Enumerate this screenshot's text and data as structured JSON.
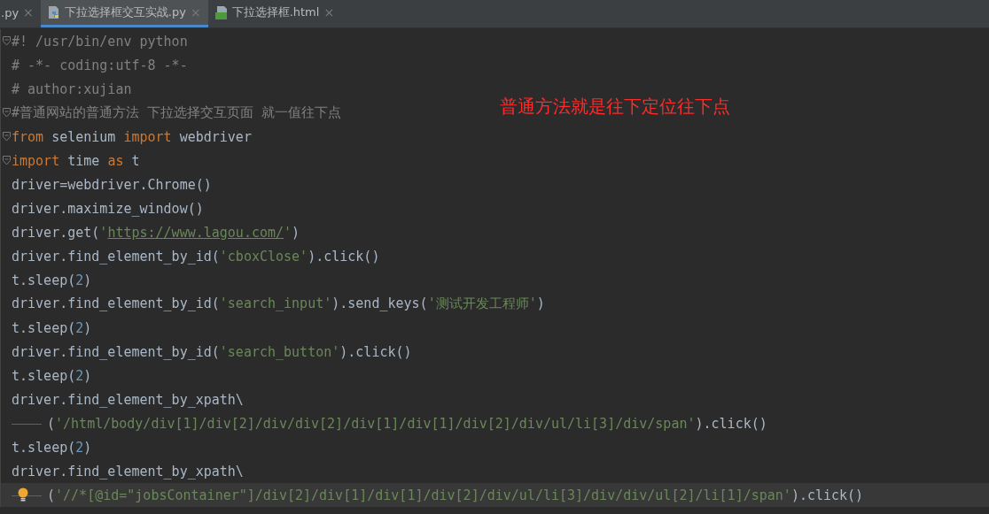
{
  "tabs": [
    {
      "label": ".py",
      "kind": "plain",
      "selected": false,
      "close": "×"
    },
    {
      "label": "下拉选择框交互实战.py",
      "kind": "python",
      "selected": true,
      "close": "×"
    },
    {
      "label": "下拉选择框.html",
      "kind": "html",
      "selected": false,
      "close": "×"
    }
  ],
  "lines": [
    {
      "fold": true,
      "wrap": false,
      "current": false,
      "hint": false,
      "tokens": [
        {
          "kind": "comment",
          "text": "#! /usr/bin/env python"
        }
      ]
    },
    {
      "fold": false,
      "wrap": false,
      "current": false,
      "hint": false,
      "tokens": [
        {
          "kind": "comment",
          "text": "# -*- coding:utf-8 -*-"
        }
      ]
    },
    {
      "fold": false,
      "wrap": false,
      "current": false,
      "hint": false,
      "tokens": [
        {
          "kind": "comment",
          "text": "# author:xujian"
        }
      ]
    },
    {
      "fold": true,
      "wrap": false,
      "current": false,
      "hint": false,
      "tokens": [
        {
          "kind": "comment",
          "text": "#普通网站的普通方法 下拉选择交互页面 就一值往下点"
        }
      ]
    },
    {
      "fold": true,
      "wrap": false,
      "current": false,
      "hint": false,
      "tokens": [
        {
          "kind": "keyword",
          "text": "from"
        },
        {
          "kind": "plain",
          "text": " selenium "
        },
        {
          "kind": "keyword",
          "text": "import"
        },
        {
          "kind": "plain",
          "text": " webdriver"
        }
      ]
    },
    {
      "fold": true,
      "wrap": false,
      "current": false,
      "hint": false,
      "tokens": [
        {
          "kind": "keyword",
          "text": "import"
        },
        {
          "kind": "plain",
          "text": " time "
        },
        {
          "kind": "keyword",
          "text": "as"
        },
        {
          "kind": "plain",
          "text": " t"
        }
      ]
    },
    {
      "fold": false,
      "wrap": false,
      "current": false,
      "hint": false,
      "tokens": [
        {
          "kind": "plain",
          "text": "driver=webdriver.Chrome()"
        }
      ]
    },
    {
      "fold": false,
      "wrap": false,
      "current": false,
      "hint": false,
      "tokens": [
        {
          "kind": "plain",
          "text": "driver.maximize_window()"
        }
      ]
    },
    {
      "fold": false,
      "wrap": false,
      "current": false,
      "hint": false,
      "tokens": [
        {
          "kind": "plain",
          "text": "driver.get("
        },
        {
          "kind": "string",
          "text": "'"
        },
        {
          "kind": "link",
          "text": "https://www.lagou.com/"
        },
        {
          "kind": "string",
          "text": "'"
        },
        {
          "kind": "plain",
          "text": ")"
        }
      ]
    },
    {
      "fold": false,
      "wrap": false,
      "current": false,
      "hint": false,
      "tokens": [
        {
          "kind": "plain",
          "text": "driver.find_element_by_id("
        },
        {
          "kind": "string",
          "text": "'cboxClose'"
        },
        {
          "kind": "plain",
          "text": ").click()"
        }
      ]
    },
    {
      "fold": false,
      "wrap": false,
      "current": false,
      "hint": false,
      "tokens": [
        {
          "kind": "plain",
          "text": "t.sleep("
        },
        {
          "kind": "number",
          "text": "2"
        },
        {
          "kind": "plain",
          "text": ")"
        }
      ]
    },
    {
      "fold": false,
      "wrap": false,
      "current": false,
      "hint": false,
      "tokens": [
        {
          "kind": "plain",
          "text": "driver.find_element_by_id("
        },
        {
          "kind": "string",
          "text": "'search_input'"
        },
        {
          "kind": "plain",
          "text": ").send_keys("
        },
        {
          "kind": "string",
          "text": "'测试开发工程师'"
        },
        {
          "kind": "plain",
          "text": ")"
        }
      ]
    },
    {
      "fold": false,
      "wrap": false,
      "current": false,
      "hint": false,
      "tokens": [
        {
          "kind": "plain",
          "text": "t.sleep("
        },
        {
          "kind": "number",
          "text": "2"
        },
        {
          "kind": "plain",
          "text": ")"
        }
      ]
    },
    {
      "fold": false,
      "wrap": false,
      "current": false,
      "hint": false,
      "tokens": [
        {
          "kind": "plain",
          "text": "driver.find_element_by_id("
        },
        {
          "kind": "string",
          "text": "'search_button'"
        },
        {
          "kind": "plain",
          "text": ").click()"
        }
      ]
    },
    {
      "fold": false,
      "wrap": false,
      "current": false,
      "hint": false,
      "tokens": [
        {
          "kind": "plain",
          "text": "t.sleep("
        },
        {
          "kind": "number",
          "text": "2"
        },
        {
          "kind": "plain",
          "text": ")"
        }
      ]
    },
    {
      "fold": false,
      "wrap": false,
      "current": false,
      "hint": false,
      "tokens": [
        {
          "kind": "plain",
          "text": "driver.find_element_by_xpath\\"
        }
      ]
    },
    {
      "fold": false,
      "wrap": true,
      "current": false,
      "hint": false,
      "tokens": [
        {
          "kind": "plain",
          "text": "("
        },
        {
          "kind": "string",
          "text": "'/html/body/div[1]/div[2]/div/div[2]/div[1]/div[1]/div[2]/div/ul/li[3]/div/span'"
        },
        {
          "kind": "plain",
          "text": ").click()"
        }
      ]
    },
    {
      "fold": false,
      "wrap": false,
      "current": false,
      "hint": false,
      "tokens": [
        {
          "kind": "plain",
          "text": "t.sleep("
        },
        {
          "kind": "number",
          "text": "2"
        },
        {
          "kind": "plain",
          "text": ")"
        }
      ]
    },
    {
      "fold": false,
      "wrap": false,
      "current": false,
      "hint": false,
      "tokens": [
        {
          "kind": "plain",
          "text": "driver.find_element_by_xpath\\"
        }
      ]
    },
    {
      "fold": false,
      "wrap": true,
      "current": true,
      "hint": true,
      "tokens": [
        {
          "kind": "plain",
          "text": "("
        },
        {
          "kind": "string",
          "text": "'//*[@id=\"jobsContainer\"]/div[2]/div[1]/div[1]/div[2]/div/ul/li[3]/div/div/ul[2]/li[1]/span'"
        },
        {
          "kind": "plain",
          "text": ").click()"
        }
      ]
    }
  ],
  "annotation": "普通方法就是往下定位往下点"
}
